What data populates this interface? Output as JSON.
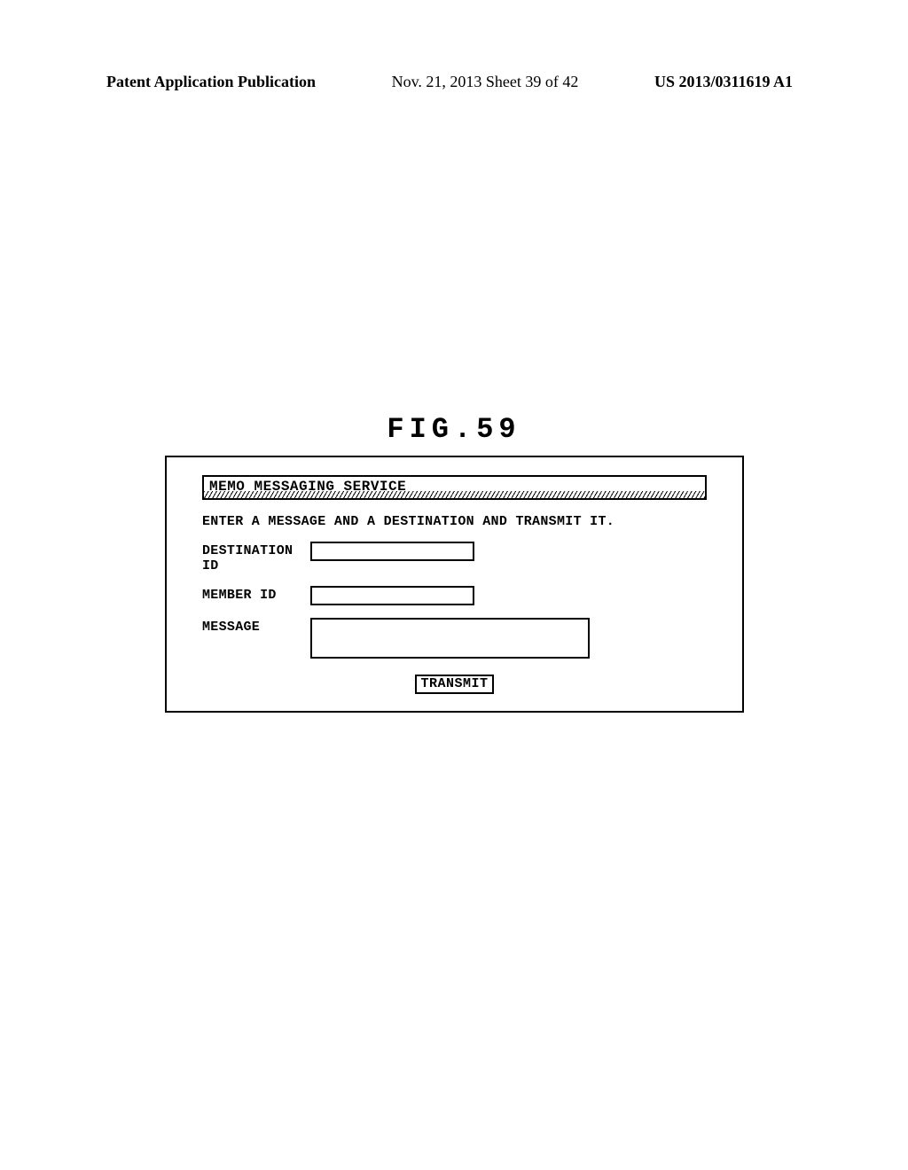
{
  "header": {
    "left": "Patent Application Publication",
    "center": "Nov. 21, 2013  Sheet 39 of 42",
    "right": "US 2013/0311619 A1"
  },
  "figure": {
    "label": "FIG.59"
  },
  "dialog": {
    "title": "MEMO MESSAGING SERVICE",
    "instruction": "ENTER A MESSAGE AND A DESTINATION AND TRANSMIT IT.",
    "fields": {
      "destination_label": "DESTINATION ID",
      "destination_value": "",
      "member_label": "MEMBER ID",
      "member_value": "",
      "message_label": "MESSAGE",
      "message_value": ""
    },
    "button": {
      "transmit_label": "TRANSMIT"
    }
  }
}
